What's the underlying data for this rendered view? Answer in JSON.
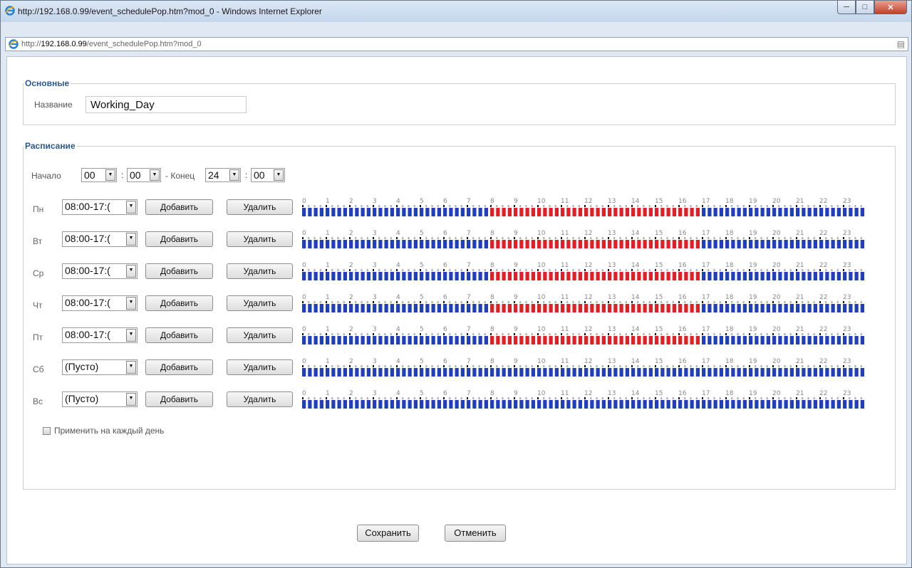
{
  "window": {
    "title": "http://192.168.0.99/event_schedulePop.htm?mod_0 - Windows Internet Explorer",
    "address_prefix": "http://",
    "address_host": "192.168.0.99",
    "address_path": "/event_schedulePop.htm?mod_0"
  },
  "basic": {
    "legend": "Основные",
    "name_label": "Название",
    "name_value": "Working_Day"
  },
  "schedule": {
    "legend": "Расписание",
    "start_label": "Начало",
    "start_hour": "00",
    "start_min": "00",
    "colon": ":",
    "end_label": "- Конец",
    "end_hour": "24",
    "end_min": "00",
    "add_label": "Добавить",
    "delete_label": "Удалить",
    "hours": [
      "0",
      "1",
      "2",
      "3",
      "4",
      "5",
      "6",
      "7",
      "8",
      "9",
      "10",
      "11",
      "12",
      "13",
      "14",
      "15",
      "16",
      "17",
      "18",
      "19",
      "20",
      "21",
      "22",
      "23"
    ],
    "colors": {
      "active": "#e31e24",
      "inactive": "#1f3fbf"
    },
    "days": [
      {
        "label": "Пн",
        "period": "08:00-17:(",
        "active": [
          8,
          17
        ]
      },
      {
        "label": "Вт",
        "period": "08:00-17:(",
        "active": [
          8,
          17
        ]
      },
      {
        "label": "Ср",
        "period": "08:00-17:(",
        "active": [
          8,
          17
        ]
      },
      {
        "label": "Чт",
        "period": "08:00-17:(",
        "active": [
          8,
          17
        ]
      },
      {
        "label": "Пт",
        "period": "08:00-17:(",
        "active": [
          8,
          17
        ]
      },
      {
        "label": "Сб",
        "period": "(Пусто)",
        "active": null
      },
      {
        "label": "Вс",
        "period": "(Пусто)",
        "active": null
      }
    ],
    "apply_every_day": "Применить на каждый день"
  },
  "footer": {
    "save": "Сохранить",
    "cancel": "Отменить"
  }
}
